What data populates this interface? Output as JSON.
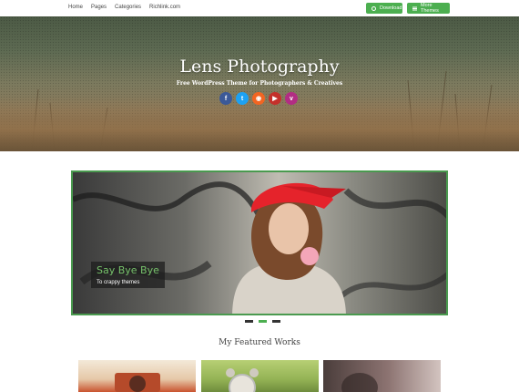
{
  "nav": {
    "items": [
      "Home",
      "Pages",
      "Categories",
      "Richlink.com"
    ]
  },
  "header_buttons": {
    "download_label": "Download",
    "more_themes_label": "More Themes",
    "accent_color": "#4caf50"
  },
  "hero": {
    "title": "Lens Photography",
    "subtitle": "Free WordPress Theme for Photographers & Creatives",
    "socials": [
      {
        "name": "facebook",
        "glyph": "f",
        "color": "#3b5998"
      },
      {
        "name": "twitter",
        "glyph": "t",
        "color": "#1da1f2"
      },
      {
        "name": "rss",
        "glyph": "◉",
        "color": "#f26522"
      },
      {
        "name": "youtube",
        "glyph": "▶",
        "color": "#c4302b"
      },
      {
        "name": "vimeo",
        "glyph": "v",
        "color": "#b22d83"
      }
    ]
  },
  "slider": {
    "heading": "Say Bye Bye",
    "text": "To crappy themes",
    "slide_count": 3,
    "active_index": 1
  },
  "featured": {
    "title": "My Featured Works"
  }
}
